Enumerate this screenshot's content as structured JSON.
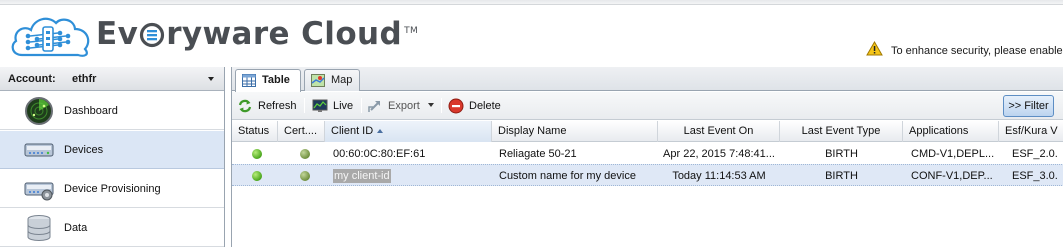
{
  "header": {
    "title_prefix": "Ev",
    "title_suffix": "ryware Cloud",
    "trademark": "TM",
    "security_message": "To enhance security, please enable"
  },
  "sidebar": {
    "account_label": "Account:",
    "account_value": "ethfr",
    "items": [
      {
        "label": "Dashboard",
        "icon": "radar-icon",
        "selected": false
      },
      {
        "label": "Devices",
        "icon": "device-icon",
        "selected": true
      },
      {
        "label": "Device Provisioning",
        "icon": "provisioning-icon",
        "selected": false
      },
      {
        "label": "Data",
        "icon": "database-icon",
        "selected": false
      }
    ]
  },
  "tabs": [
    {
      "label": "Table",
      "icon": "table-icon",
      "active": true
    },
    {
      "label": "Map",
      "icon": "map-icon",
      "active": false
    }
  ],
  "toolbar": {
    "refresh": "Refresh",
    "live": "Live",
    "export": "Export",
    "delete": "Delete",
    "filter": ">> Filter"
  },
  "grid": {
    "columns": [
      "Status",
      "Cert....",
      "Client ID",
      "Display Name",
      "Last Event On",
      "Last Event Type",
      "Applications",
      "Esf/Kura V"
    ],
    "sorted_column": "Client ID",
    "sort_direction": "ascending",
    "rows": [
      {
        "client_id": "00:60:0C:80:EF:61",
        "display_name": "Reliagate 50-21",
        "last_event_on": "Apr 22, 2015 7:48:41...",
        "last_event_type": "BIRTH",
        "applications": "CMD-V1,DEPL...",
        "esf_version": "ESF_2.0.",
        "selected": false
      },
      {
        "client_id": "my client-id",
        "display_name": "Custom name for my device",
        "last_event_on": "Today 11:14:53 AM",
        "last_event_type": "BIRTH",
        "applications": "CONF-V1,DEP...",
        "esf_version": "ESF_3.0.",
        "selected": true
      }
    ]
  },
  "colors": {
    "brand_text": "#4a4e53",
    "brand_blue": "#2f8fd8",
    "selection": "#dbe6f5",
    "status_green": "#4aa61c"
  }
}
